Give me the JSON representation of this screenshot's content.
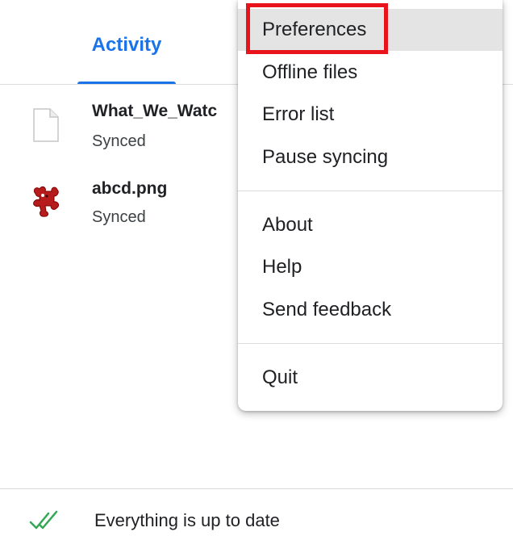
{
  "tabs": {
    "activity_label": "Activity"
  },
  "files": [
    {
      "name": "What_We_Watc",
      "status": "Synced",
      "icon": "blank-document-icon"
    },
    {
      "name": "abcd.png",
      "status": "Synced",
      "icon": "image-viewer-puzzle-icon"
    }
  ],
  "footer": {
    "status_text": "Everything is up to date",
    "icon": "double-check-icon"
  },
  "menu": {
    "items": [
      "Preferences",
      "Offline files",
      "Error list",
      "Pause syncing",
      "About",
      "Help",
      "Send feedback",
      "Quit"
    ],
    "hovered_item": "Preferences"
  },
  "colors": {
    "accent": "#1a73e8",
    "highlight": "#e8131b",
    "success_green": "#34a853"
  }
}
